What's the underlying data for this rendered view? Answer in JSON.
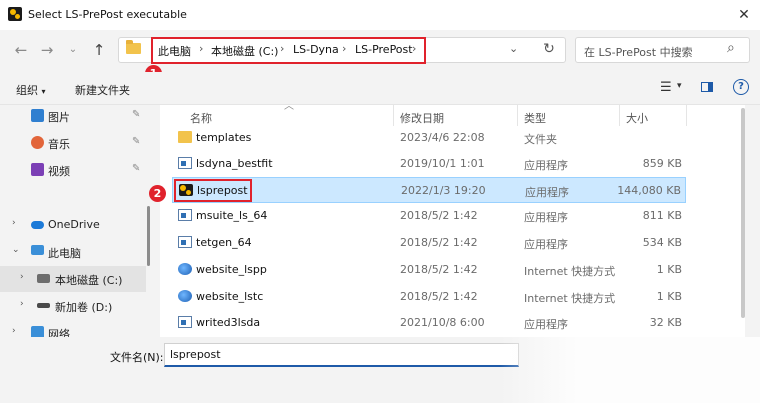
{
  "window": {
    "title": "Select LS-PrePost executable"
  },
  "address": {
    "crumbs": [
      "此电脑",
      "本地磁盘 (C:)",
      "LS-Dyna",
      "LS-PrePost"
    ],
    "separator": "›"
  },
  "search": {
    "placeholder": "在 LS-PrePost 中搜索"
  },
  "toolbar": {
    "organize": "组织",
    "new_folder": "新建文件夹"
  },
  "badges": {
    "one": "1",
    "two": "2"
  },
  "sidebar": {
    "items": [
      {
        "label": "图片",
        "icon": "pictures-icon",
        "pinned": true
      },
      {
        "label": "音乐",
        "icon": "music-icon",
        "pinned": true
      },
      {
        "label": "视频",
        "icon": "video-icon",
        "pinned": true
      },
      {
        "label": "OneDrive",
        "icon": "onedrive-icon"
      },
      {
        "label": "此电脑",
        "icon": "this-pc-icon"
      },
      {
        "label": "本地磁盘 (C:)",
        "icon": "drive-c-icon",
        "selected": true
      },
      {
        "label": "新加卷 (D:)",
        "icon": "drive-d-icon"
      },
      {
        "label": "网络",
        "icon": "network-icon"
      }
    ]
  },
  "columns": {
    "name": "名称",
    "modified": "修改日期",
    "type": "类型",
    "size": "大小"
  },
  "files": [
    {
      "name": "templates",
      "modified": "2023/4/6 22:08",
      "type": "文件夹",
      "size": "",
      "icon": "folder-icon"
    },
    {
      "name": "lsdyna_bestfit",
      "modified": "2019/10/1 1:01",
      "type": "应用程序",
      "size": "859 KB",
      "icon": "application-icon"
    },
    {
      "name": "lsprepost",
      "modified": "2022/1/3 19:20",
      "type": "应用程序",
      "size": "144,080 KB",
      "icon": "lsprepost-icon",
      "selected": true
    },
    {
      "name": "msuite_ls_64",
      "modified": "2018/5/2 1:42",
      "type": "应用程序",
      "size": "811 KB",
      "icon": "application-icon"
    },
    {
      "name": "tetgen_64",
      "modified": "2018/5/2 1:42",
      "type": "应用程序",
      "size": "534 KB",
      "icon": "application-icon"
    },
    {
      "name": "website_lspp",
      "modified": "2018/5/2 1:42",
      "type": "Internet 快捷方式",
      "size": "1 KB",
      "icon": "internet-shortcut-icon"
    },
    {
      "name": "website_lstc",
      "modified": "2018/5/2 1:42",
      "type": "Internet 快捷方式",
      "size": "1 KB",
      "icon": "internet-shortcut-icon"
    },
    {
      "name": "writed3lsda",
      "modified": "2021/10/8 6:00",
      "type": "应用程序",
      "size": "32 KB",
      "icon": "application-icon"
    }
  ],
  "filename": {
    "label": "文件名(N):",
    "value": "lsprepost"
  },
  "colors": {
    "annotation_red": "#e0222c",
    "selection_blue": "#cce8ff",
    "folder_yellow": "#f2c34c"
  }
}
